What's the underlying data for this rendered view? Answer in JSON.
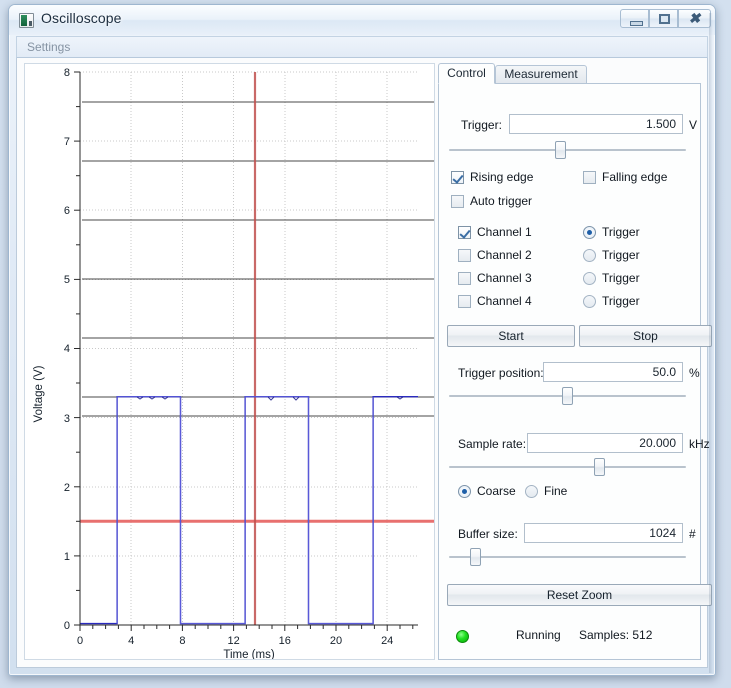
{
  "window": {
    "title": "Oscilloscope",
    "icon": "app-icon",
    "minimize_label": "–",
    "maximize_label": "□",
    "close_label": "✕"
  },
  "menubar": {
    "settings_label": "Settings"
  },
  "tabs": [
    {
      "id": "control",
      "label": "Control",
      "selected": true
    },
    {
      "id": "measurement",
      "label": "Measurement",
      "selected": false
    }
  ],
  "control": {
    "trigger": {
      "label": "Trigger:",
      "value": "1.500",
      "unit": "V",
      "slider_percent": 47
    },
    "edge": {
      "rising": {
        "label": "Rising edge",
        "checked": true
      },
      "falling": {
        "label": "Falling edge",
        "checked": false
      },
      "auto": {
        "label": "Auto trigger",
        "checked": false
      }
    },
    "channels": [
      {
        "label": "Channel 1",
        "checked": true,
        "trigger_label": "Trigger",
        "trigger_selected": true
      },
      {
        "label": "Channel 2",
        "checked": false,
        "trigger_label": "Trigger",
        "trigger_selected": false
      },
      {
        "label": "Channel 3",
        "checked": false,
        "trigger_label": "Trigger",
        "trigger_selected": false
      },
      {
        "label": "Channel 4",
        "checked": false,
        "trigger_label": "Trigger",
        "trigger_selected": false
      }
    ],
    "buttons": {
      "start": "Start",
      "stop": "Stop",
      "reset_zoom": "Reset Zoom"
    },
    "trigger_position": {
      "label": "Trigger position:",
      "value": "50.0",
      "unit": "%",
      "slider_percent": 50
    },
    "sample_rate": {
      "label": "Sample rate:",
      "value": "20.000",
      "unit": "kHz",
      "slider_percent": 61
    },
    "resolution": {
      "coarse": {
        "label": "Coarse",
        "selected": true
      },
      "fine": {
        "label": "Fine",
        "selected": false
      }
    },
    "buffer_size": {
      "label": "Buffer size:",
      "value": "1024",
      "unit": "#",
      "slider_percent": 5
    },
    "status": {
      "state": "Running",
      "samples": "Samples: 512",
      "led_color": "#21e021"
    }
  },
  "chart_data": {
    "type": "line",
    "title": "",
    "xlabel": "Time (ms)",
    "ylabel": "Voltage (V)",
    "xlim": [
      0,
      26.4
    ],
    "ylim": [
      0,
      8
    ],
    "xticks": [
      0,
      4,
      8,
      12,
      16,
      20,
      24
    ],
    "yticks": [
      0,
      1,
      2,
      3,
      4,
      5,
      6,
      7,
      8
    ],
    "grid": true,
    "series": [
      {
        "name": "Channel 1",
        "color": "#2b2bbf",
        "description": "square wave, low 0.02 V, high 3.30 V, period 10 ms, duty 50%",
        "low_level": 0.02,
        "high_level": 3.3,
        "period_ms": 10.0,
        "duty_percent": 50,
        "edges_ms": [
          2.9,
          7.85,
          12.9,
          17.85,
          22.9,
          27.85
        ]
      }
    ],
    "markers": [
      {
        "name": "trigger-level",
        "orientation": "horizontal",
        "value": 1.5,
        "color": "#e8706f",
        "unit": "V"
      },
      {
        "name": "trigger-position",
        "orientation": "vertical",
        "value": 12.7,
        "color": "#c0504d",
        "unit": "ms"
      }
    ]
  }
}
